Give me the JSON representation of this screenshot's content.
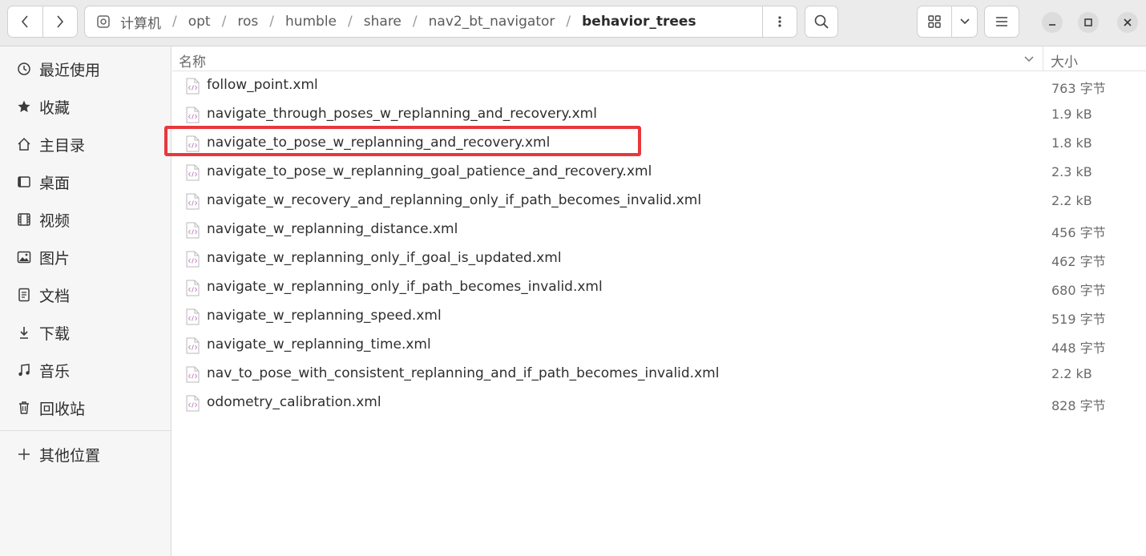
{
  "header": {
    "path": [
      "计算机",
      "opt",
      "ros",
      "humble",
      "share",
      "nav2_bt_navigator",
      "behavior_trees"
    ],
    "back_icon": "chevron-left-icon",
    "forward_icon": "chevron-right-icon",
    "search_icon": "search-icon",
    "view_icon": "grid-view-icon",
    "menu_icon": "hamburger-icon"
  },
  "sidebar": {
    "items": [
      {
        "label": "最近使用",
        "icon": "recent-icon"
      },
      {
        "label": "收藏",
        "icon": "star-icon"
      },
      {
        "label": "主目录",
        "icon": "home-icon"
      },
      {
        "label": "桌面",
        "icon": "desktop-icon"
      },
      {
        "label": "视频",
        "icon": "video-icon"
      },
      {
        "label": "图片",
        "icon": "image-icon"
      },
      {
        "label": "文档",
        "icon": "document-icon"
      },
      {
        "label": "下载",
        "icon": "download-icon"
      },
      {
        "label": "音乐",
        "icon": "music-icon"
      },
      {
        "label": "回收站",
        "icon": "trash-icon"
      },
      {
        "label": "其他位置",
        "icon": "plus-icon"
      }
    ]
  },
  "columns": {
    "name": "名称",
    "size": "大小"
  },
  "files": [
    {
      "name": "follow_point.xml",
      "size": "763 字节"
    },
    {
      "name": "navigate_through_poses_w_replanning_and_recovery.xml",
      "size": "1.9 kB"
    },
    {
      "name": "navigate_to_pose_w_replanning_and_recovery.xml",
      "size": "1.8 kB"
    },
    {
      "name": "navigate_to_pose_w_replanning_goal_patience_and_recovery.xml",
      "size": "2.3 kB"
    },
    {
      "name": "navigate_w_recovery_and_replanning_only_if_path_becomes_invalid.xml",
      "size": "2.2 kB"
    },
    {
      "name": "navigate_w_replanning_distance.xml",
      "size": "456 字节"
    },
    {
      "name": "navigate_w_replanning_only_if_goal_is_updated.xml",
      "size": "462 字节"
    },
    {
      "name": "navigate_w_replanning_only_if_path_becomes_invalid.xml",
      "size": "680 字节"
    },
    {
      "name": "navigate_w_replanning_speed.xml",
      "size": "519 字节"
    },
    {
      "name": "navigate_w_replanning_time.xml",
      "size": "448 字节"
    },
    {
      "name": "nav_to_pose_with_consistent_replanning_and_if_path_becomes_invalid.xml",
      "size": "2.2 kB"
    },
    {
      "name": "odometry_calibration.xml",
      "size": "828 字节"
    }
  ],
  "colors": {
    "highlight": "#e8383d",
    "xml_icon": "#c77fc7"
  }
}
